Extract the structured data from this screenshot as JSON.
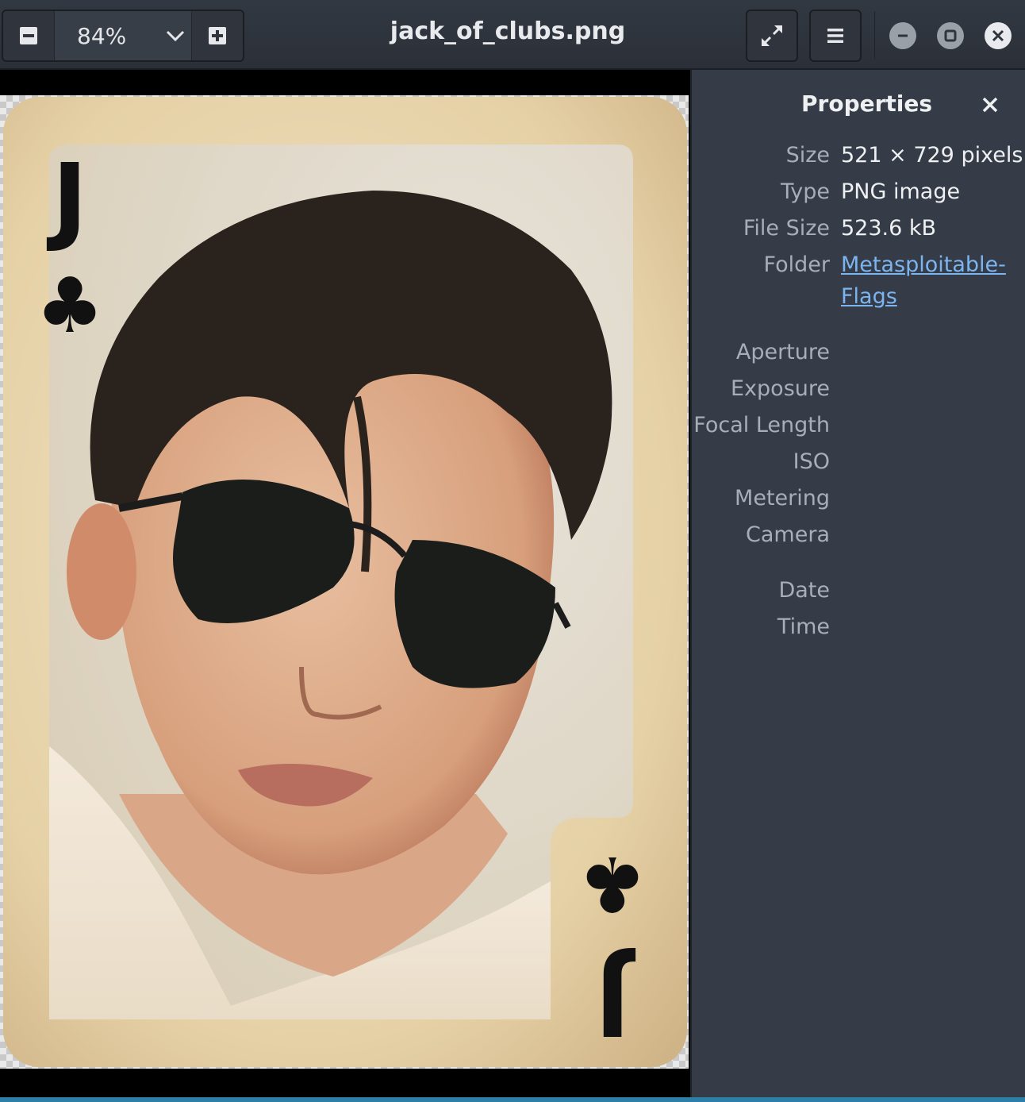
{
  "header": {
    "zoom_value": "84%",
    "title": "jack_of_clubs.png",
    "zoom_out_icon": "zoom-out-icon",
    "zoom_in_icon": "zoom-in-icon",
    "fullscreen_icon": "fullscreen-icon",
    "menu_icon": "hamburger-menu-icon",
    "minimize_icon": "minimize-icon",
    "maximize_icon": "maximize-icon",
    "close_icon": "close-icon"
  },
  "image": {
    "card_rank": "J",
    "card_suit": "♣",
    "card_rank_bottom": "J",
    "card_suit_bottom": "♣"
  },
  "properties": {
    "title": "Properties",
    "size_label": "Size",
    "size_value": "521 × 729 pixels",
    "type_label": "Type",
    "type_value": "PNG image",
    "file_size_label": "File Size",
    "file_size_value": "523.6 kB",
    "folder_label": "Folder",
    "folder_value": "Metasploitable-Flags",
    "aperture_label": "Aperture",
    "exposure_label": "Exposure",
    "focal_length_label": "Focal Length",
    "iso_label": "ISO",
    "metering_label": "Metering",
    "camera_label": "Camera",
    "date_label": "Date",
    "time_label": "Time"
  },
  "colors": {
    "headerbar": "#2f343d",
    "sidebar": "#353c47",
    "link": "#7cb4f0",
    "card_paper": "#e8d6b0",
    "suit": "#111111"
  }
}
